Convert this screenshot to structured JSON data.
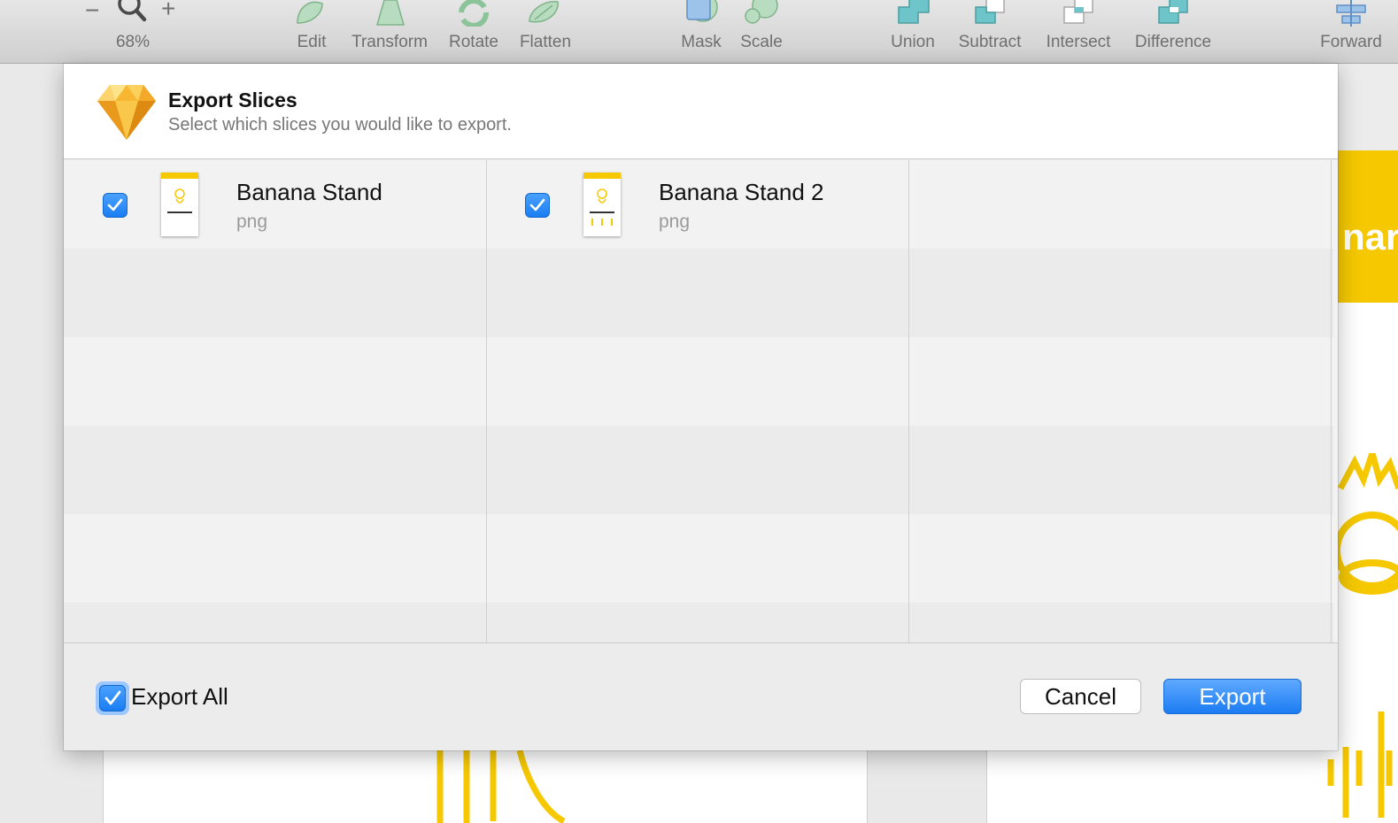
{
  "toolbar": {
    "zoom": {
      "minus": "−",
      "plus": "+",
      "percent": "68%"
    },
    "tools": [
      {
        "label": "Edit"
      },
      {
        "label": "Transform"
      },
      {
        "label": "Rotate"
      },
      {
        "label": "Flatten"
      },
      {
        "label": "Mask"
      },
      {
        "label": "Scale"
      },
      {
        "label": "Union"
      },
      {
        "label": "Subtract"
      },
      {
        "label": "Intersect"
      },
      {
        "label": "Difference"
      },
      {
        "label": "Forward"
      }
    ]
  },
  "canvas": {
    "band_text": "nar"
  },
  "dialog": {
    "title": "Export Slices",
    "subtitle": "Select which slices you would like to export.",
    "slices": [
      {
        "name": "Banana Stand",
        "format": "png",
        "checked": true
      },
      {
        "name": "Banana Stand 2",
        "format": "png",
        "checked": true
      }
    ],
    "export_all_label": "Export All",
    "export_all_checked": true,
    "cancel_label": "Cancel",
    "export_label": "Export"
  },
  "colors": {
    "accent_blue": "#1a7df2",
    "banana_yellow": "#f5c800"
  }
}
